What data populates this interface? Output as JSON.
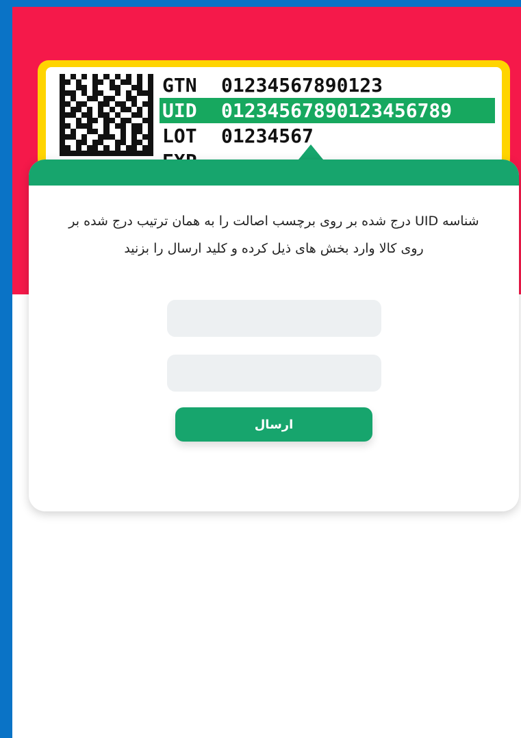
{
  "page": {
    "background_color": "#0a73c6",
    "surface_color": "#ffffff",
    "hero_color": "#f5194a"
  },
  "label_card": {
    "border_color": "#ffd400",
    "highlight_color": "#17a85f",
    "lines": [
      {
        "prefix": "GTN",
        "value": "01234567890123"
      },
      {
        "prefix": "UID",
        "value": "01234567890123456789"
      },
      {
        "prefix": "LOT",
        "value": "01234567"
      },
      {
        "prefix": "EXP",
        "value": ""
      }
    ]
  },
  "form": {
    "instruction": "شناسه UID درج شده بر روی برچسب اصالت را به همان ترتیب درج شده بر روی کالا وارد بخش های ذیل کرده و کلید ارسال را بزنید",
    "field_1": {
      "value": "",
      "placeholder": ""
    },
    "field_2": {
      "value": "",
      "placeholder": ""
    },
    "submit_label": "ارسال",
    "accent_color": "#17a56d",
    "field_color": "#edf0f2"
  },
  "icons": {
    "barcode": "data-matrix-icon"
  }
}
